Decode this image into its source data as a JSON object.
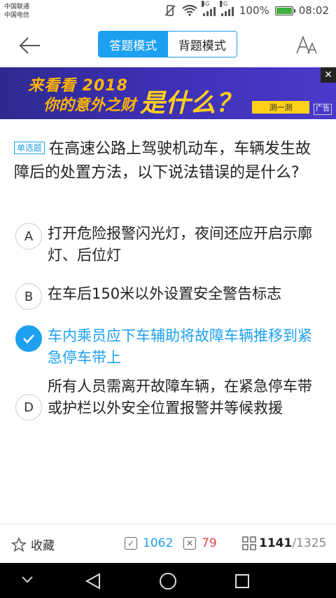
{
  "status": {
    "carrier1": "中国联通",
    "carrier2": "中国电信",
    "net1": "4G",
    "net2": "2G",
    "battery": "100%",
    "time": "08:02"
  },
  "header": {
    "mode_answer": "答题模式",
    "mode_recite": "背题模式"
  },
  "ad": {
    "line1": "来看看 2018",
    "line2": "你的意外之财",
    "headline": "是什么？",
    "cta": "测一测",
    "tag": "广告",
    "close": "✕"
  },
  "question": {
    "type": "单选题",
    "text": "在高速公路上驾驶机动车，车辆发生故障后的处置方法，以下说法错误的是什么?"
  },
  "options": [
    {
      "letter": "A",
      "text": "打开危险报警闪光灯，夜间还应开启示廓灯、后位灯"
    },
    {
      "letter": "B",
      "text": "在车后150米以外设置安全警告标志"
    },
    {
      "letter": "C",
      "text": "车内乘员应下车辅助将故障车辆推移到紧急停车带上",
      "selected": true
    },
    {
      "letter": "D",
      "text": "所有人员需离开故障车辆，在紧急停车带或护栏以外安全位置报警并等候救援"
    }
  ],
  "bottom": {
    "favorite": "收藏",
    "correct_count": "1062",
    "wrong_count": "79",
    "current": "1141",
    "total": "/1325"
  },
  "colors": {
    "accent": "#1ea0f0",
    "wrong": "#e04848"
  }
}
